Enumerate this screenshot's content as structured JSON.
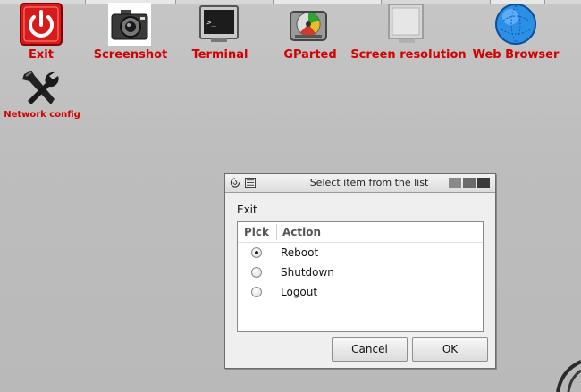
{
  "desktop": {
    "icons": [
      {
        "label": "Exit",
        "icon": "power-icon"
      },
      {
        "label": "Screenshot",
        "icon": "camera-icon"
      },
      {
        "label": "Terminal",
        "icon": "terminal-icon"
      },
      {
        "label": "GParted",
        "icon": "disk-icon"
      },
      {
        "label": "Screen resolution",
        "icon": "monitor-icon"
      },
      {
        "label": "Web Browser",
        "icon": "globe-icon"
      },
      {
        "label": "Network config",
        "icon": "tools-icon"
      }
    ],
    "label_color": "#d40000"
  },
  "dialog": {
    "title": "Select item from the list",
    "prompt": "Exit",
    "columns": [
      "Pick",
      "Action"
    ],
    "items": [
      {
        "label": "Reboot",
        "selected": true
      },
      {
        "label": "Shutdown",
        "selected": false
      },
      {
        "label": "Logout",
        "selected": false
      }
    ],
    "cancel_label": "Cancel",
    "ok_label": "OK"
  }
}
